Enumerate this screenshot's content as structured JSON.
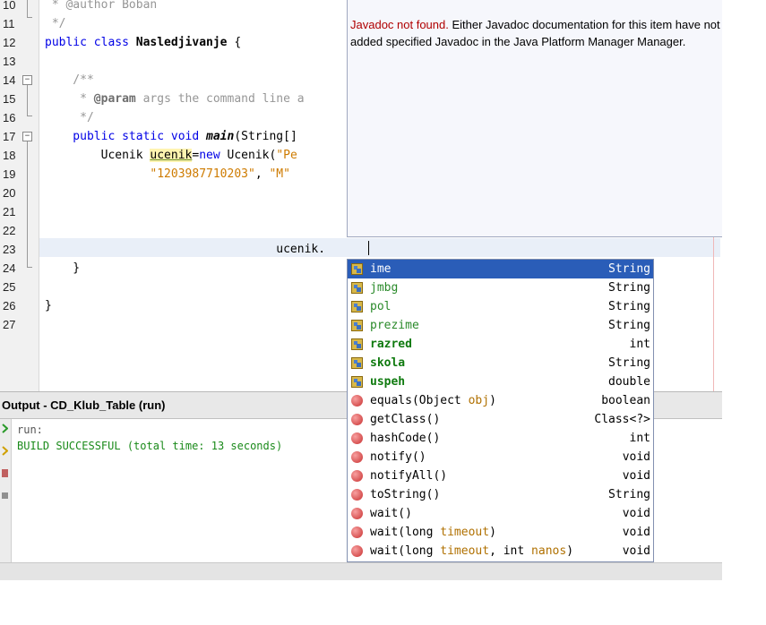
{
  "editor": {
    "line_numbers": [
      "10",
      "11",
      "12",
      "13",
      "14",
      "15",
      "16",
      "17",
      "18",
      "19",
      "20",
      "21",
      "22",
      "23",
      "24",
      "25",
      "26",
      "27"
    ],
    "lines": {
      "l10_comment": " * @author Boban",
      "l11_comment": " */",
      "l12_kw": "public class ",
      "l12_name": "Nasledjivanje",
      "l12_rest": " {",
      "l14_comment": "    /**",
      "l15_comment_a": "     * ",
      "l15_param": "@param",
      "l15_comment_b": " args the command line a",
      "l16_comment": "     */",
      "l17_kw": "    public static void ",
      "l17_method": "main",
      "l17_rest": "(String[]",
      "l18_a": "        Ucenik ",
      "l18_var": "ucenik",
      "l18_eq": "=",
      "l18_kw": "new",
      "l18_b": " Ucenik(",
      "l18_str": "\"Pe",
      "l19_indent": "               ",
      "l19_str1": "\"1203987710203\"",
      "l19_comma": ", ",
      "l19_str2": "\"M\"",
      "l23": "                                 ucenik.",
      "l24": "    }",
      "l26": "}"
    }
  },
  "javadoc": {
    "not_found": "Javadoc not found.",
    "message": " Either Javadoc documentation for this item have not added specified Javadoc in the Java Platform Manager Manager."
  },
  "output": {
    "title": "Output - CD_Klub_Table (run)",
    "lines": [
      "run:",
      "BUILD SUCCESSFUL (total time: 13 seconds)"
    ]
  },
  "completion": {
    "items": [
      {
        "kind": "field",
        "name": "ime",
        "type": "String",
        "selected": true
      },
      {
        "kind": "field",
        "name": "jmbg",
        "type": "String"
      },
      {
        "kind": "field",
        "name": "pol",
        "type": "String"
      },
      {
        "kind": "field",
        "name": "prezime",
        "type": "String"
      },
      {
        "kind": "field",
        "name": "razred",
        "type": "int",
        "bold": true
      },
      {
        "kind": "field",
        "name": "skola",
        "type": "String",
        "bold": true
      },
      {
        "kind": "field",
        "name": "uspeh",
        "type": "double",
        "bold": true
      },
      {
        "kind": "method",
        "name": "equals(Object ",
        "param": "obj",
        "name_end": ")",
        "type": "boolean"
      },
      {
        "kind": "method",
        "name": "getClass()",
        "type": "Class<?>"
      },
      {
        "kind": "method",
        "name": "hashCode()",
        "type": "int"
      },
      {
        "kind": "method",
        "name": "notify()",
        "type": "void"
      },
      {
        "kind": "method",
        "name": "notifyAll()",
        "type": "void"
      },
      {
        "kind": "method",
        "name": "toString()",
        "type": "String"
      },
      {
        "kind": "method",
        "name": "wait()",
        "type": "void"
      },
      {
        "kind": "method",
        "name": "wait(long ",
        "param": "timeout",
        "name_end": ")",
        "type": "void"
      },
      {
        "kind": "method",
        "name": "wait(long ",
        "param": "timeout",
        "mid": ", int ",
        "param2": "nanos",
        "name_end": ")",
        "type": "void"
      }
    ]
  },
  "colors": {
    "selection": "#2a5db8",
    "keyword": "#0000e6",
    "string": "#ce7b00",
    "comment": "#969696",
    "build_success": "#1a8a1a",
    "javadoc_error": "#b00000"
  }
}
